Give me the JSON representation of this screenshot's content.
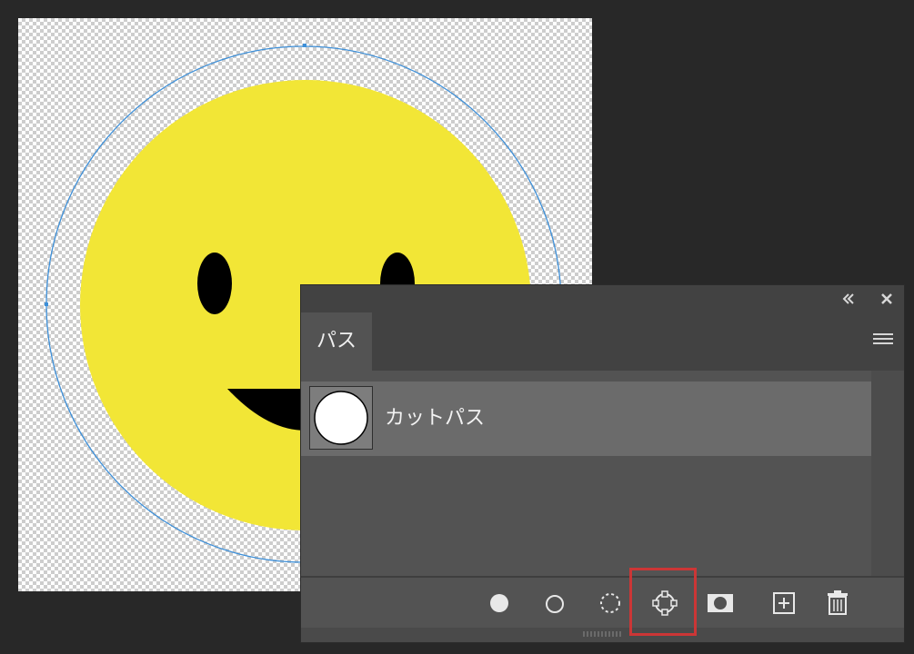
{
  "panel": {
    "tab_label": "パス",
    "collapse_icon": "collapse-double-arrow-icon",
    "close_icon": "close-icon",
    "menu_icon": "panel-menu-icon"
  },
  "paths": [
    {
      "name": "カットパス",
      "thumbnail": "circle-path-thumbnail"
    }
  ],
  "toolbar": {
    "buttons": [
      {
        "icon": "fill-path-icon"
      },
      {
        "icon": "stroke-path-icon"
      },
      {
        "icon": "load-path-as-selection-icon"
      },
      {
        "icon": "make-work-path-from-selection-icon",
        "highlighted": true
      },
      {
        "icon": "add-mask-icon"
      },
      {
        "icon": "create-new-path-icon"
      },
      {
        "icon": "delete-path-icon"
      }
    ]
  },
  "colors": {
    "highlight": "#cc3636",
    "smiley_face": "#f2e636",
    "path_outline": "#3d8fd8"
  }
}
